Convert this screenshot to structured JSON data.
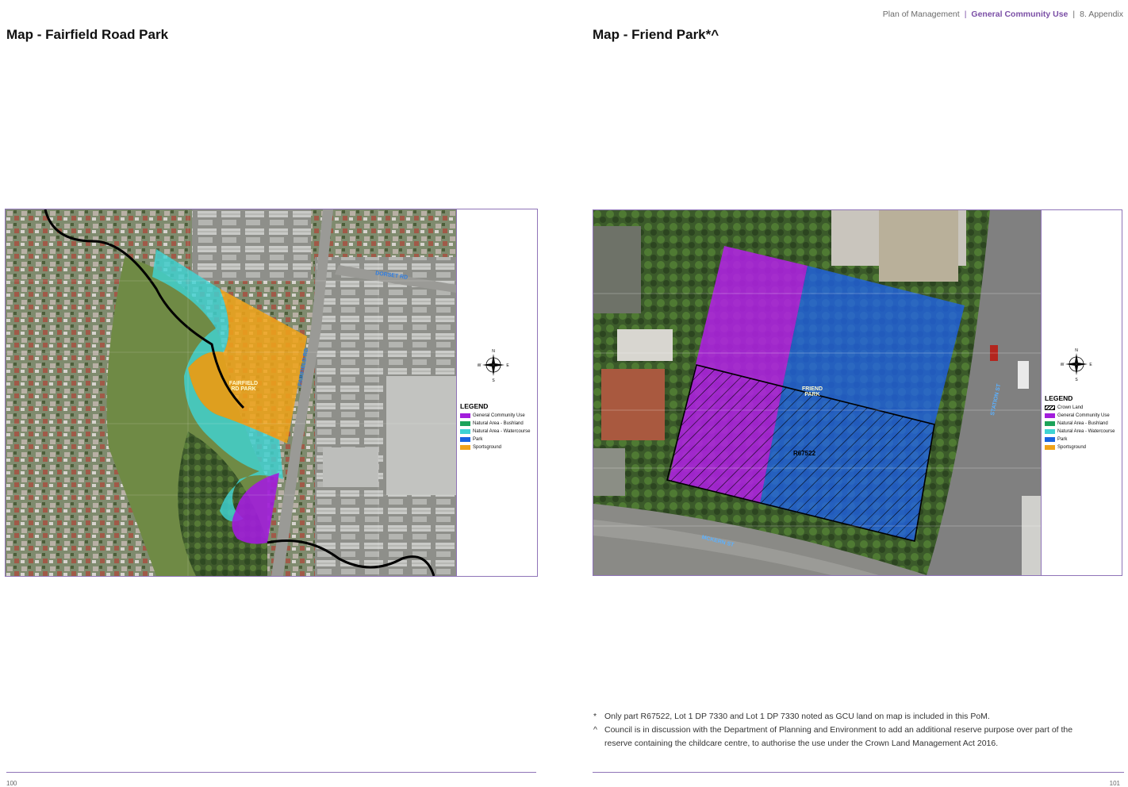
{
  "header": {
    "crumb1": "Plan of Management",
    "crumb2": "General Community Use",
    "crumb3": "8. Appendix"
  },
  "left": {
    "title": "Map - Fairfield Road Park",
    "map_labels": {
      "road1": "FAIRFIELD RD",
      "road2": "DORSET RD",
      "park1": "FAIRFIELD",
      "park2": "RD PARK"
    },
    "legend": {
      "title": "LEGEND",
      "items": [
        {
          "label": "General Community Use",
          "color": "#a21ddc"
        },
        {
          "label": "Natural Area - Bushland",
          "color": "#1ca35a"
        },
        {
          "label": "Natural Area - Watercourse",
          "color": "#3fd3d3"
        },
        {
          "label": "Park",
          "color": "#1a64e0"
        },
        {
          "label": "Sportsground",
          "color": "#f0a31a"
        }
      ]
    },
    "page_number": "100"
  },
  "right": {
    "title": "Map - Friend Park*^",
    "map_labels": {
      "park1": "FRIEND",
      "park2": "PARK",
      "lot": "R67522",
      "street1": "STATION ST",
      "street2": "MCKERN ST"
    },
    "legend": {
      "title": "LEGEND",
      "items": [
        {
          "label": "Crown Land",
          "color": "hatch"
        },
        {
          "label": "General Community Use",
          "color": "#a21ddc"
        },
        {
          "label": "Natural Area - Bushland",
          "color": "#1ca35a"
        },
        {
          "label": "Natural Area - Watercourse",
          "color": "#3fd3d3"
        },
        {
          "label": "Park",
          "color": "#1a64e0"
        },
        {
          "label": "Sportsground",
          "color": "#f0a31a"
        }
      ]
    },
    "footnotes": [
      {
        "mark": "*",
        "text": "Only part R67522, Lot 1 DP 7330 and Lot 1 DP 7330 noted as GCU land on map is included in this PoM."
      },
      {
        "mark": "^",
        "text": "Council is in discussion with the Department of Planning and Environment to add an additional reserve purpose over part of the reserve containing the childcare centre, to authorise the use under the Crown Land Management Act 2016."
      }
    ],
    "page_number": "101"
  },
  "compass": {
    "n": "N",
    "s": "S",
    "e": "E",
    "w": "W"
  },
  "colors": {
    "accent": "#7b4fa6"
  }
}
